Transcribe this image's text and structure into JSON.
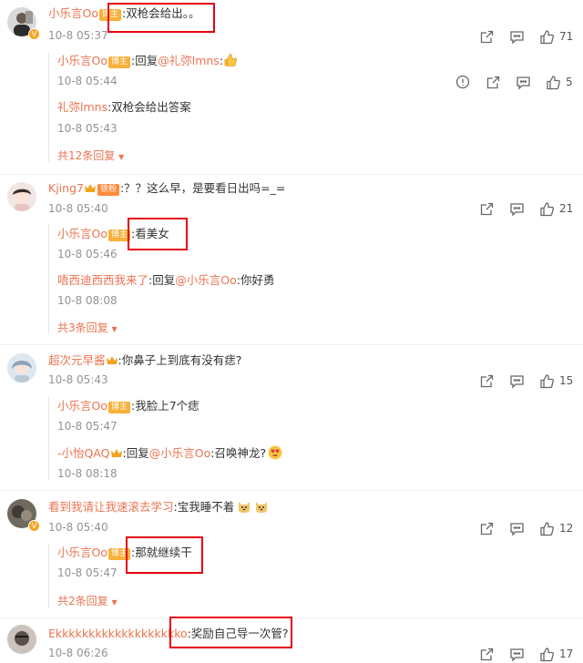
{
  "colors": {
    "accent": "#eb7350",
    "highlight": "#e60012",
    "time": "#939393"
  },
  "comments": [
    {
      "user": "小乐言Oo",
      "tag": "博主",
      "text": ":双枪会给出。。",
      "time": "10-8 05:37",
      "likes": "71",
      "replies": [
        {
          "user": "小乐言Oo",
          "tag": "博主",
          "text_prefix": ":回复",
          "mention": "@礼弥lmns",
          "text": ":",
          "emoji": "thumbs-up-emoji",
          "time": "10-8 05:44",
          "likes": "5"
        },
        {
          "user": "礼弥lmns",
          "text": ":双枪会给出答案",
          "time": "10-8 05:43"
        }
      ],
      "more": "共12条回复"
    },
    {
      "user": "Kjing7",
      "tag": "铁粉",
      "text": ":？？这么早，是要看日出吗=_=",
      "time": "10-8 05:40",
      "likes": "21",
      "replies": [
        {
          "user": "小乐言Oo",
          "tag": "博主",
          "text": ":看美女",
          "time": "10-8 05:46"
        },
        {
          "user": "唔西迪西西我来了",
          "text_prefix": ":回复",
          "mention": "@小乐言Oo",
          "text": ":你好勇",
          "time": "10-8 08:08"
        }
      ],
      "more": "共3条回复"
    },
    {
      "user": "超次元早酱",
      "text": ":你鼻子上到底有没有痣?",
      "time": "10-8 05:43",
      "likes": "15",
      "replies": [
        {
          "user": "小乐言Oo",
          "tag": "博主",
          "text": ":我脸上7个痣",
          "time": "10-8 05:47"
        },
        {
          "user": "-小怡QAQ",
          "text_prefix": ":回复",
          "mention": "@小乐言Oo",
          "text": ":召唤神龙?",
          "time": "10-8 08:18"
        }
      ]
    },
    {
      "user": "看到我请让我速滚去学习",
      "text": ":宝我睡不着",
      "time": "10-8 05:40",
      "likes": "12",
      "replies": [
        {
          "user": "小乐言Oo",
          "tag": "博主",
          "text": ":那就继续干",
          "time": "10-8 05:47"
        }
      ],
      "more": "共2条回复"
    },
    {
      "user": "Ekkkkkkkkkkkkkkkkkkko",
      "text": ":奖励自己导一次管?",
      "time": "10-8 06:26",
      "likes": "17"
    }
  ]
}
